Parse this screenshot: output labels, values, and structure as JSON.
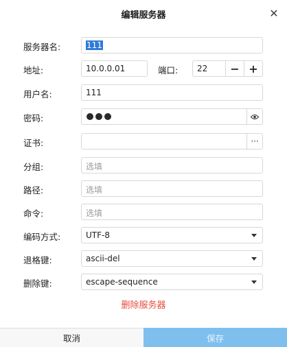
{
  "dialog": {
    "title": "编辑服务器",
    "close_glyph": "✕"
  },
  "form": {
    "server_name": {
      "label": "服务器名:",
      "value": "111"
    },
    "address": {
      "label": "地址:",
      "value": "10.0.0.01"
    },
    "port": {
      "label": "端口:",
      "value": "22",
      "minus": "−",
      "plus": "+"
    },
    "username": {
      "label": "用户名:",
      "value": "111"
    },
    "password": {
      "label": "密码:",
      "masked_dots": 3,
      "toggle_icon": "eye-icon",
      "toggle_glyph": "◉"
    },
    "certificate": {
      "label": "证书:",
      "value": "",
      "browse_glyph": "···"
    },
    "group": {
      "label": "分组:",
      "placeholder": "选填"
    },
    "path": {
      "label": "路径:",
      "placeholder": "选填"
    },
    "command": {
      "label": "命令:",
      "placeholder": "选填"
    },
    "encoding": {
      "label": "编码方式:",
      "selected": "UTF-8"
    },
    "backspace_key": {
      "label": "退格键:",
      "selected": "ascii-del"
    },
    "delete_key": {
      "label": "删除键:",
      "selected": "escape-sequence"
    }
  },
  "actions": {
    "delete_server": "删除服务器",
    "cancel": "取消",
    "save": "保存"
  },
  "colors": {
    "danger": "#e74c3c",
    "primary_disabled": "#7fbfee",
    "selection": "#2f7bd8"
  }
}
